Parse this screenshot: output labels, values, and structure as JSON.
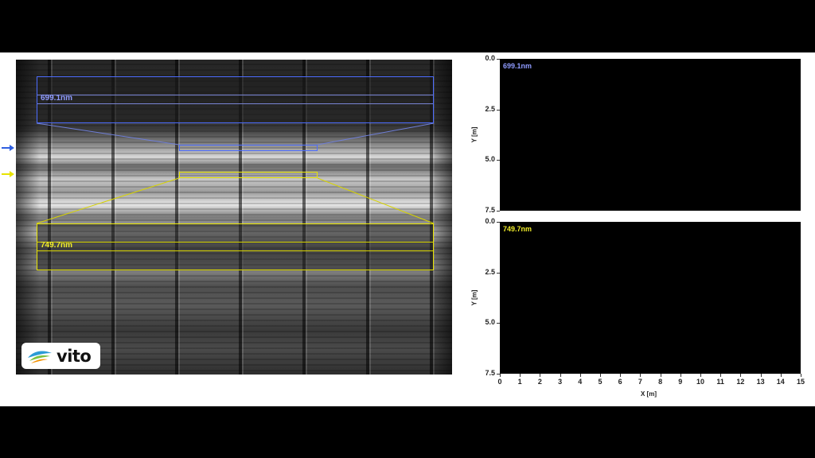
{
  "left_image": {
    "blue_band_label": "699.1nm",
    "yellow_band_label": "749.7nm",
    "logo_text": "vito",
    "colors": {
      "blue": "#4c6cff",
      "yellow": "#e7e300"
    }
  },
  "plots": {
    "top": {
      "band_label": "699.1nm"
    },
    "bottom": {
      "band_label": "749.7nm"
    },
    "y_label": "Y [m]",
    "x_label": "X [m]",
    "y_ticks": [
      "0.0",
      "2.5",
      "5.0",
      "7.5"
    ],
    "x_ticks": [
      "0",
      "1",
      "2",
      "3",
      "4",
      "5",
      "6",
      "7",
      "8",
      "9",
      "10",
      "11",
      "12",
      "13",
      "14",
      "15"
    ]
  }
}
